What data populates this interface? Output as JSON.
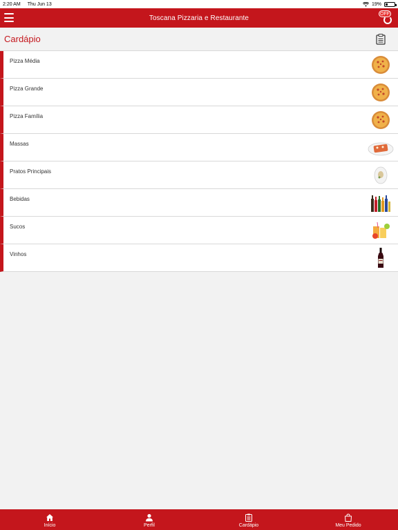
{
  "status_bar": {
    "time": "2:20 AM",
    "date": "Thu Jun 13",
    "battery": "19%"
  },
  "header": {
    "title": "Toscana Pizzaria e Restaurante",
    "off_label": "OFF"
  },
  "section": {
    "title": "Cardápio"
  },
  "menu": {
    "items": [
      {
        "label": "Pizza Média",
        "icon": "pizza-icon"
      },
      {
        "label": "Pizza Grande",
        "icon": "pizza-icon"
      },
      {
        "label": "Pizza Família",
        "icon": "pizza-icon"
      },
      {
        "label": "Massas",
        "icon": "pasta-plate-icon"
      },
      {
        "label": "Pratos Principais",
        "icon": "dish-icon"
      },
      {
        "label": "Bebidas",
        "icon": "bottles-icon"
      },
      {
        "label": "Sucos",
        "icon": "juice-icon"
      },
      {
        "label": "Vinhos",
        "icon": "wine-bottle-icon"
      }
    ]
  },
  "tabs": [
    {
      "label": "Início",
      "icon": "home-icon"
    },
    {
      "label": "Perfil",
      "icon": "user-icon"
    },
    {
      "label": "Cardápio",
      "icon": "clipboard-icon"
    },
    {
      "label": "Meu Pedido",
      "icon": "shopping-bag-icon"
    }
  ],
  "colors": {
    "brand_red": "#c4161c",
    "background": "#f2f2f2"
  }
}
